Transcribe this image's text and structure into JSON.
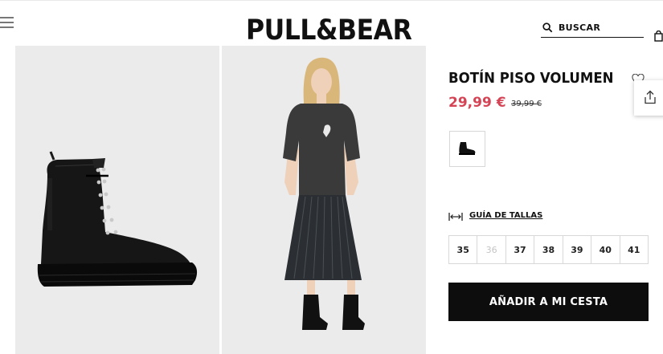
{
  "header": {
    "logo": "PULL&BEAR",
    "search_label": "BUSCAR"
  },
  "product": {
    "title": "BOTÍN PISO VOLUMEN",
    "price": "29,99 €",
    "old_price": "39,99 €",
    "size_guide_label": "GUÍA DE TALLAS",
    "sizes": [
      {
        "label": "35",
        "available": true
      },
      {
        "label": "36",
        "available": false
      },
      {
        "label": "37",
        "available": true
      },
      {
        "label": "38",
        "available": true
      },
      {
        "label": "39",
        "available": true
      },
      {
        "label": "40",
        "available": true
      },
      {
        "label": "41",
        "available": true
      }
    ],
    "add_to_cart_label": "AÑADIR A MI CESTA"
  },
  "colors": {
    "price": "#d44455",
    "button_bg": "#0d0d0d",
    "image_bg": "#ebebeb"
  },
  "icons": [
    "menu-icon",
    "search-icon",
    "bag-icon",
    "heart-icon",
    "share-icon",
    "size-guide-icon"
  ]
}
